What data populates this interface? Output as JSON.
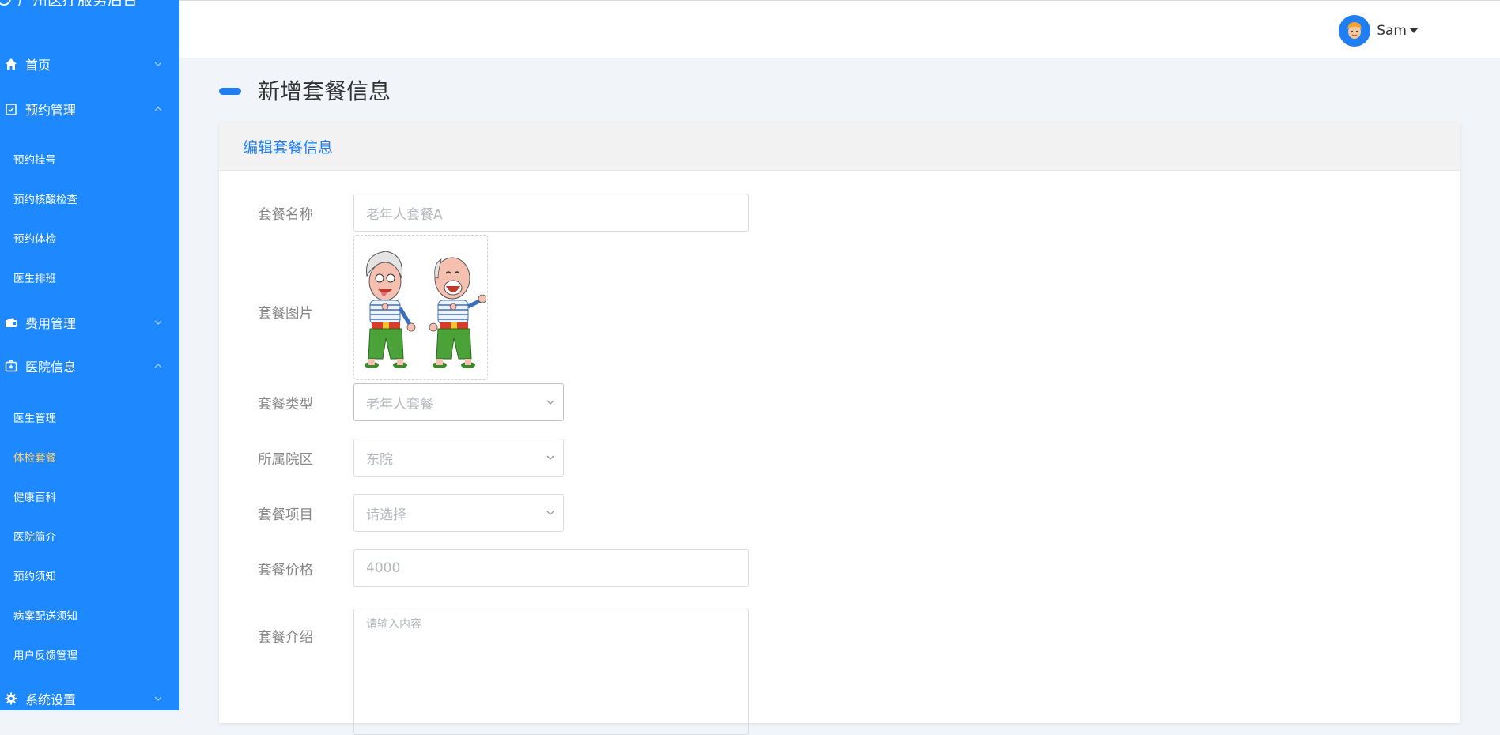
{
  "sidebar": {
    "brand": "广州医疗服务后台",
    "menu": [
      {
        "label": "首页",
        "icon": "home-icon"
      },
      {
        "label": "预约管理",
        "icon": "clipboard-check-icon"
      },
      {
        "label": "费用管理",
        "icon": "wallet-icon"
      },
      {
        "label": "医院信息",
        "icon": "medical-kit-icon"
      },
      {
        "label": "系统设置",
        "icon": "gear-icon"
      }
    ],
    "appointment_sub": [
      "预约挂号",
      "预约核酸检查",
      "预约体检",
      "医生排班"
    ],
    "hospital_sub": [
      "医生管理",
      "体检套餐",
      "健康百科",
      "医院简介",
      "预约须知",
      "病案配送须知",
      "用户反馈管理"
    ],
    "active_sub": "体检套餐"
  },
  "header": {
    "username": "Sam"
  },
  "page": {
    "title": "新增套餐信息",
    "card_title": "编辑套餐信息"
  },
  "form": {
    "name_label": "套餐名称",
    "name_value": "老年人套餐A",
    "image_label": "套餐图片",
    "type_label": "套餐类型",
    "type_value": "老年人套餐",
    "area_label": "所属院区",
    "area_value": "东院",
    "items_label": "套餐项目",
    "items_placeholder": "请选择",
    "price_label": "套餐价格",
    "price_value": "4000",
    "intro_label": "套餐介绍",
    "intro_placeholder": "请输入内容"
  },
  "colors": {
    "sidebar_bg": "#1e88ff",
    "accent": "#1e7ef2",
    "active_sub": "#ffd36a",
    "page_bg": "#f1f4f9"
  }
}
